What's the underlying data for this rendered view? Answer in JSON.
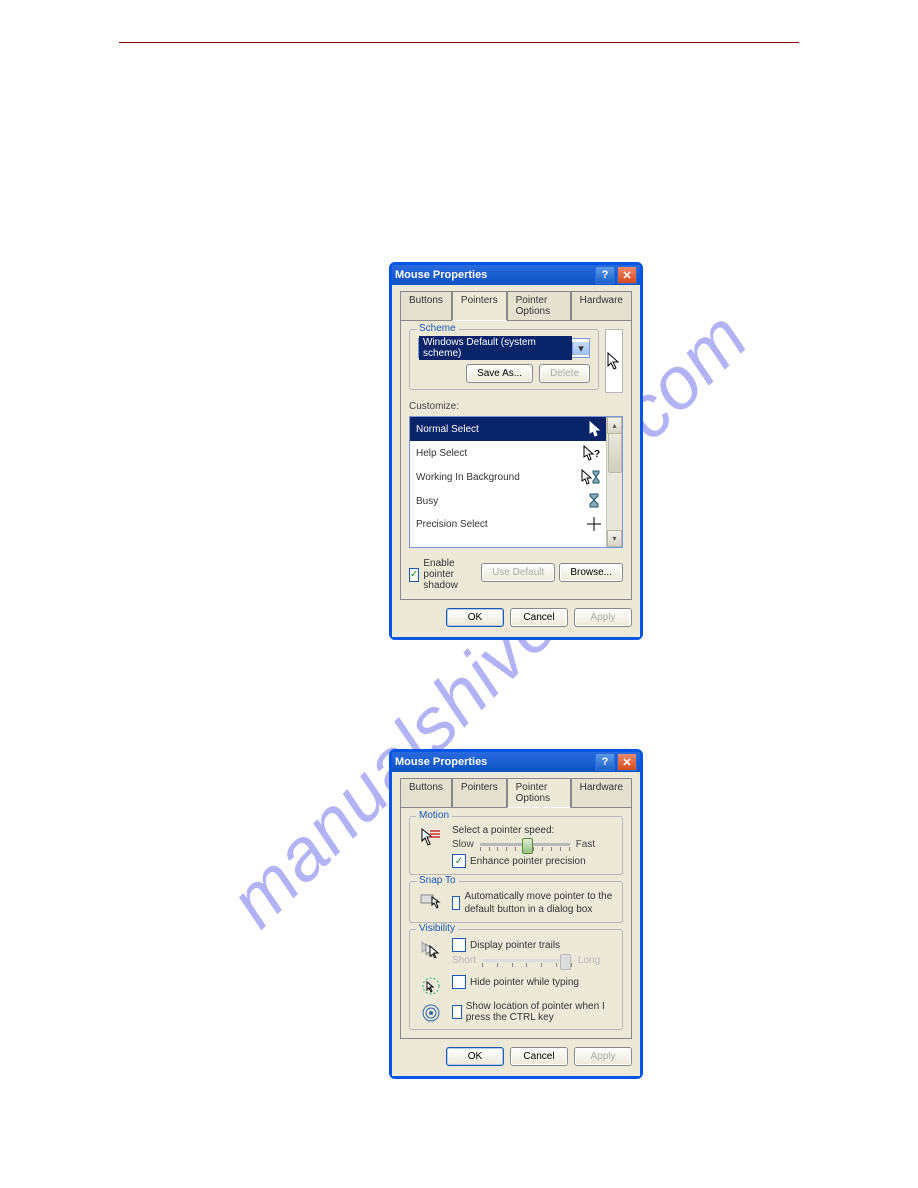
{
  "colors": {
    "titlebar": "#0b52c0",
    "close": "#d34a1f",
    "selection": "#0a246a",
    "legend": "#1b57b5"
  },
  "window1": {
    "title": "Mouse Properties",
    "tabs": [
      "Buttons",
      "Pointers",
      "Pointer Options",
      "Hardware"
    ],
    "active_tab": 1,
    "scheme": {
      "legend": "Scheme",
      "selected": "Windows Default (system scheme)",
      "save_as": "Save As...",
      "delete": "Delete"
    },
    "customize_label": "Customize:",
    "pointers": [
      {
        "name": "Normal Select",
        "selected": true
      },
      {
        "name": "Help Select",
        "selected": false
      },
      {
        "name": "Working In Background",
        "selected": false
      },
      {
        "name": "Busy",
        "selected": false
      },
      {
        "name": "Precision Select",
        "selected": false
      }
    ],
    "enable_shadow": {
      "label": "Enable pointer shadow",
      "checked": true
    },
    "use_default": "Use Default",
    "browse": "Browse...",
    "ok": "OK",
    "cancel": "Cancel",
    "apply": "Apply"
  },
  "window2": {
    "title": "Mouse Properties",
    "tabs": [
      "Buttons",
      "Pointers",
      "Pointer Options",
      "Hardware"
    ],
    "active_tab": 2,
    "motion": {
      "legend": "Motion",
      "speed_label": "Select a pointer speed:",
      "slow": "Slow",
      "fast": "Fast",
      "enhance": {
        "label": "Enhance pointer precision",
        "checked": true
      }
    },
    "snap": {
      "legend": "Snap To",
      "label": "Automatically move pointer to the default button in a dialog box",
      "checked": false
    },
    "visibility": {
      "legend": "Visibility",
      "trails": {
        "label": "Display pointer trails",
        "checked": false,
        "short": "Short",
        "long": "Long"
      },
      "hide": {
        "label": "Hide pointer while typing",
        "checked": false
      },
      "ctrl": {
        "label": "Show location of pointer when I press the CTRL key",
        "checked": false
      }
    },
    "ok": "OK",
    "cancel": "Cancel",
    "apply": "Apply"
  }
}
